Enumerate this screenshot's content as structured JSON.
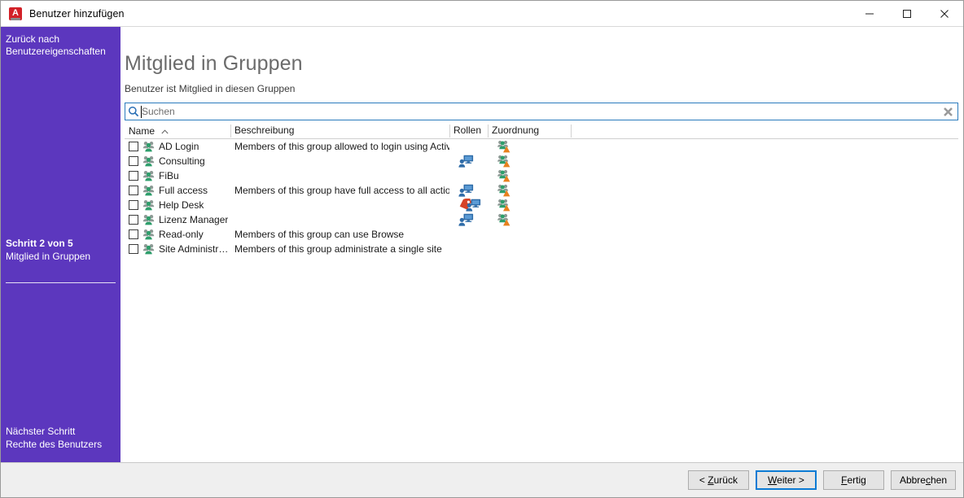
{
  "window": {
    "title": "Benutzer hinzufügen",
    "app_icon": "adito-app-icon",
    "icon_letter": "A",
    "controls": [
      {
        "name": "minimize-button",
        "glyph": "minimize-icon"
      },
      {
        "name": "maximize-button",
        "glyph": "maximize-icon"
      },
      {
        "name": "close-button",
        "glyph": "close-icon"
      }
    ]
  },
  "sidebar": {
    "back_line1": "Zurück nach",
    "back_line2": "Benutzereigenschaften",
    "current_step": "Schritt 2 von 5",
    "current_name": "Mitglied in Gruppen",
    "next_label": "Nächster Schritt",
    "next_name": "Rechte des Benutzers",
    "color": "#5c37be"
  },
  "main": {
    "title": "Mitglied in Gruppen",
    "subtitle": "Benutzer ist Mitglied in diesen Gruppen"
  },
  "search": {
    "placeholder": "Suchen",
    "value": "",
    "icon": "search-icon",
    "clear_icon": "clear-icon",
    "border_color": "#2a7bbd"
  },
  "table": {
    "columns": [
      {
        "key": "name",
        "label": "Name",
        "sort": "ascending",
        "sort_glyph": "sort-ascending-icon"
      },
      {
        "key": "description",
        "label": "Beschreibung"
      },
      {
        "key": "roles",
        "label": "Rollen"
      },
      {
        "key": "assignment",
        "label": "Zuordnung"
      }
    ],
    "rows": [
      {
        "checked": false,
        "group_icon": "group-icon",
        "name": "AD Login",
        "description": "Members of this group allowed to login using Active …",
        "roles": [],
        "assignment": [
          "assignment-icon"
        ]
      },
      {
        "checked": false,
        "group_icon": "group-icon",
        "name": "Consulting",
        "description": "",
        "roles": [
          "role-icon"
        ],
        "assignment": [
          "assignment-icon"
        ]
      },
      {
        "checked": false,
        "group_icon": "group-icon",
        "name": "FiBu",
        "description": "",
        "roles": [],
        "assignment": [
          "assignment-icon"
        ]
      },
      {
        "checked": false,
        "group_icon": "group-icon",
        "name": "Full access",
        "description": "Members of this group have full access to all actions",
        "roles": [
          "role-icon"
        ],
        "assignment": [
          "assignment-icon"
        ]
      },
      {
        "checked": false,
        "group_icon": "group-icon",
        "name": "Help Desk",
        "description": "",
        "roles": [
          "tag-icon",
          "role-icon"
        ],
        "assignment": [
          "assignment-icon"
        ]
      },
      {
        "checked": false,
        "group_icon": "group-icon",
        "name": "Lizenz Manager",
        "description": "",
        "roles": [
          "role-icon"
        ],
        "assignment": [
          "assignment-icon"
        ]
      },
      {
        "checked": false,
        "group_icon": "group-icon",
        "name": "Read-only",
        "description": "Members of this group can use Browse",
        "roles": [],
        "assignment": []
      },
      {
        "checked": false,
        "group_icon": "group-icon",
        "name": "Site Administr…",
        "description": "Members of this group administrate a single site",
        "roles": [],
        "assignment": []
      }
    ]
  },
  "footer": {
    "buttons": [
      {
        "name": "back-button",
        "text": "< Zurück",
        "pre": "< ",
        "accel": "Z",
        "post": "urück",
        "default": false
      },
      {
        "name": "next-button",
        "text": "Weiter >",
        "pre": "",
        "accel": "W",
        "post": "eiter >",
        "default": true
      },
      {
        "name": "finish-button",
        "text": "Fertig",
        "pre": "",
        "accel": "F",
        "post": "ertig",
        "default": false
      },
      {
        "name": "cancel-button",
        "text": "Abbrechen",
        "pre": "Abbre",
        "accel": "c",
        "post": "hen",
        "default": false
      }
    ]
  }
}
